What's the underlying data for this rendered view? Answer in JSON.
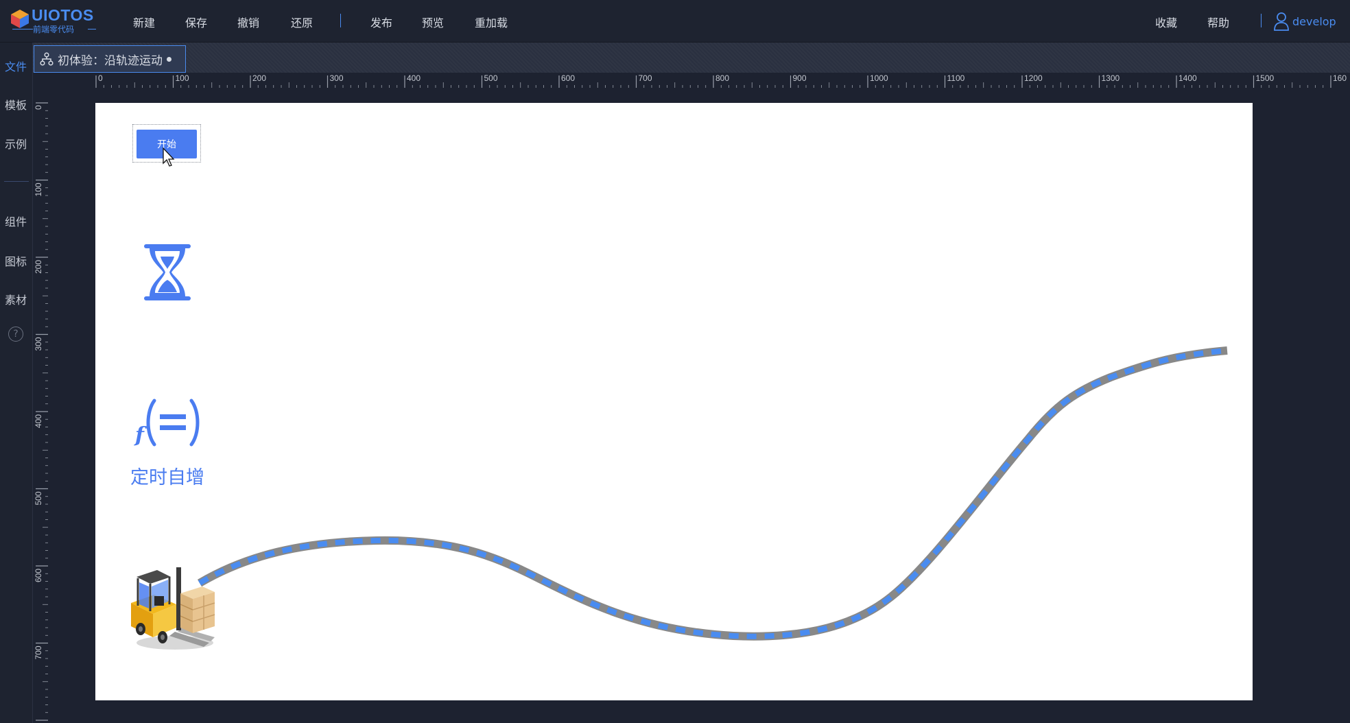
{
  "app": {
    "logo_title": "UIOTOS",
    "logo_subtitle": "前端零代码"
  },
  "header": {
    "menu_left": [
      {
        "id": "new",
        "label": "新建"
      },
      {
        "id": "save",
        "label": "保存"
      },
      {
        "id": "undo",
        "label": "撤销"
      },
      {
        "id": "redo",
        "label": "还原"
      },
      {
        "id": "publish",
        "label": "发布"
      },
      {
        "id": "preview",
        "label": "预览"
      },
      {
        "id": "reload",
        "label": "重加载"
      }
    ],
    "menu_right": [
      {
        "id": "favorites",
        "label": "收藏"
      },
      {
        "id": "help",
        "label": "帮助"
      }
    ],
    "user": {
      "name": "develop",
      "icon": "user-icon"
    }
  },
  "sidebar": {
    "items": [
      {
        "id": "file",
        "label": "文件",
        "active": true
      },
      {
        "id": "template",
        "label": "模板",
        "active": false
      },
      {
        "id": "example",
        "label": "示例",
        "active": false
      },
      {
        "id": "component",
        "label": "组件",
        "active": false
      },
      {
        "id": "icon",
        "label": "图标",
        "active": false
      },
      {
        "id": "material",
        "label": "素材",
        "active": false
      }
    ],
    "help_glyph": "?"
  },
  "tab": {
    "icon": "flow-graph-icon",
    "title": "初体验：沿轨迹运动",
    "modified_dot": true
  },
  "ruler": {
    "horizontal": [
      "0",
      "100",
      "200",
      "300",
      "400",
      "500",
      "600",
      "700",
      "800",
      "900",
      "1000",
      "1100",
      "1200",
      "1300",
      "1400",
      "1500",
      "160"
    ],
    "vertical": [
      "0",
      "100",
      "200",
      "300",
      "400",
      "500",
      "600",
      "700"
    ]
  },
  "canvas": {
    "start_button_label": "开始",
    "hourglass_icon": "hourglass-icon",
    "function_icon": "function-icon",
    "timer_label": "定时自增",
    "forklift_image": "forklift-image",
    "track_colors": {
      "rail": "#888888",
      "dash": "#4a8cf0"
    }
  },
  "colors": {
    "accent": "#4a8cf0",
    "button": "#4a7cf0",
    "topbar": "#1e2330",
    "canvas_bg": "#ffffff"
  }
}
